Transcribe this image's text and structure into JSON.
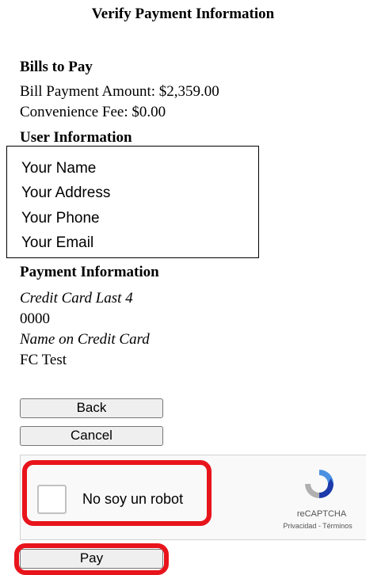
{
  "page": {
    "title": "Verify Payment Information"
  },
  "bills": {
    "heading": "Bills to Pay",
    "amount_line": "Bill Payment Amount: $2,359.00",
    "fee_line": "Convenience Fee: $0.00"
  },
  "user": {
    "heading": "User Information",
    "name": "Your Name",
    "address": "Your Address",
    "phone": "Your Phone",
    "email": "Your Email"
  },
  "payment": {
    "heading": "Payment Information",
    "card_last4_label": "Credit Card Last 4",
    "card_last4_value": "0000",
    "name_label": "Name on Credit Card",
    "name_value": "FC Test"
  },
  "buttons": {
    "back": "Back",
    "cancel": "Cancel",
    "pay": "Pay"
  },
  "captcha": {
    "label": "No soy un robot",
    "brand": "reCAPTCHA",
    "links": "Privacidad - Términos",
    "checked": false,
    "icon": "recaptcha-logo-icon"
  },
  "colors": {
    "highlight": "#e8141b",
    "captcha_blue": "#1c3aa9",
    "captcha_bg": "#f9f9f9"
  }
}
